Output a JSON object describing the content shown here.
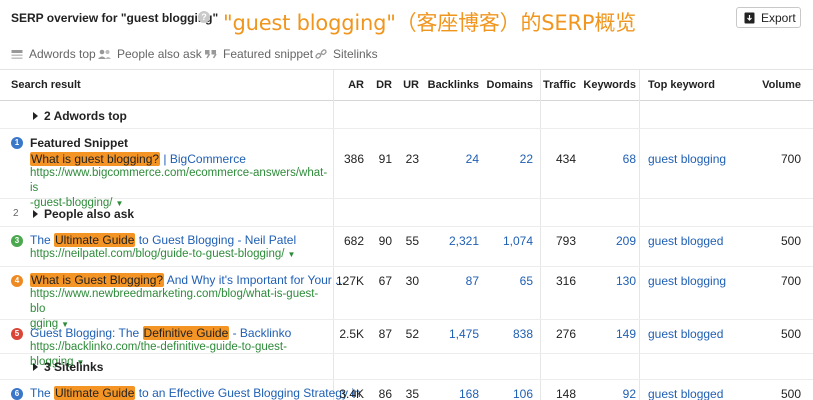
{
  "header": {
    "title": "SERP overview for \"guest blogging\"",
    "help_icon": "?",
    "caption": "\"guest blogging\"（客座博客）的SERP概览",
    "export_label": "Export"
  },
  "filters": [
    {
      "label": "Adwords top",
      "icon": "adwords-icon"
    },
    {
      "label": "People also ask",
      "icon": "people-icon"
    },
    {
      "label": "Featured snippet",
      "icon": "quote-icon"
    },
    {
      "label": "Sitelinks",
      "icon": "link-icon"
    }
  ],
  "columns": {
    "result": "Search result",
    "ar": "AR",
    "dr": "DR",
    "ur": "UR",
    "backlinks": "Backlinks",
    "domains": "Domains",
    "traffic": "Traffic",
    "keywords": "Keywords",
    "top_keyword": "Top keyword",
    "volume": "Volume"
  },
  "groups": {
    "adwords": "2 Adwords top",
    "paa_num": "2",
    "paa": "People also ask",
    "sitelinks": "3 Sitelinks"
  },
  "rows": [
    {
      "pos": "1",
      "subtitle": "Featured Snippet",
      "title_hl": "What is guest blogging?",
      "title_rest": " | BigCommerce",
      "url": "https://www.bigcommerce.com/ecommerce-answers/what-is-guest-blogging/",
      "ar": "386",
      "dr": "91",
      "ur": "23",
      "backlinks": "24",
      "domains": "22",
      "traffic": "434",
      "keywords": "68",
      "top_keyword": "guest blogging",
      "volume": "700"
    },
    {
      "pos": "3",
      "title_pre": "The ",
      "title_hl": "Ultimate Guide",
      "title_rest": " to Guest Blogging - Neil Patel",
      "url": "https://neilpatel.com/blog/guide-to-guest-blogging/",
      "ar": "682",
      "dr": "90",
      "ur": "55",
      "backlinks": "2,321",
      "domains": "1,074",
      "traffic": "793",
      "keywords": "209",
      "top_keyword": "guest blogged",
      "volume": "500"
    },
    {
      "pos": "4",
      "title_hl": "What is Guest Blogging?",
      "title_rest": " And Why it's Important for Your ...",
      "url": "https://www.newbreedmarketing.com/blog/what-is-guest-blogging",
      "ar": "127K",
      "dr": "67",
      "ur": "30",
      "backlinks": "87",
      "domains": "65",
      "traffic": "316",
      "keywords": "130",
      "top_keyword": "guest blogging",
      "volume": "700"
    },
    {
      "pos": "5",
      "title_pre": "Guest Blogging: The ",
      "title_hl": "Definitive Guide",
      "title_rest": " - Backlinko",
      "url": "https://backlinko.com/the-definitive-guide-to-guest-blogging",
      "ar": "2.5K",
      "dr": "87",
      "ur": "52",
      "backlinks": "1,475",
      "domains": "838",
      "traffic": "276",
      "keywords": "149",
      "top_keyword": "guest blogged",
      "volume": "500"
    },
    {
      "pos": "6",
      "title_pre": "The ",
      "title_hl": "Ultimate Guide",
      "title_rest": " to an Effective Guest Blogging Strategy in",
      "ar": "3.4K",
      "dr": "86",
      "ur": "35",
      "backlinks": "168",
      "domains": "106",
      "traffic": "148",
      "keywords": "92",
      "top_keyword": "guest blogged",
      "volume": "500"
    }
  ],
  "url_wraps": {
    "r0a": "https://www.bigcommerce.com/ecommerce-answers/what-is",
    "r0b": "-guest-blogging/",
    "r2a": "https://www.newbreedmarketing.com/blog/what-is-guest-blo",
    "r2b": "gging"
  },
  "colors": {
    "accent": "#f0961e",
    "link": "#1f5fb4",
    "url": "#2e8b3a",
    "highlight": "#f39424"
  }
}
